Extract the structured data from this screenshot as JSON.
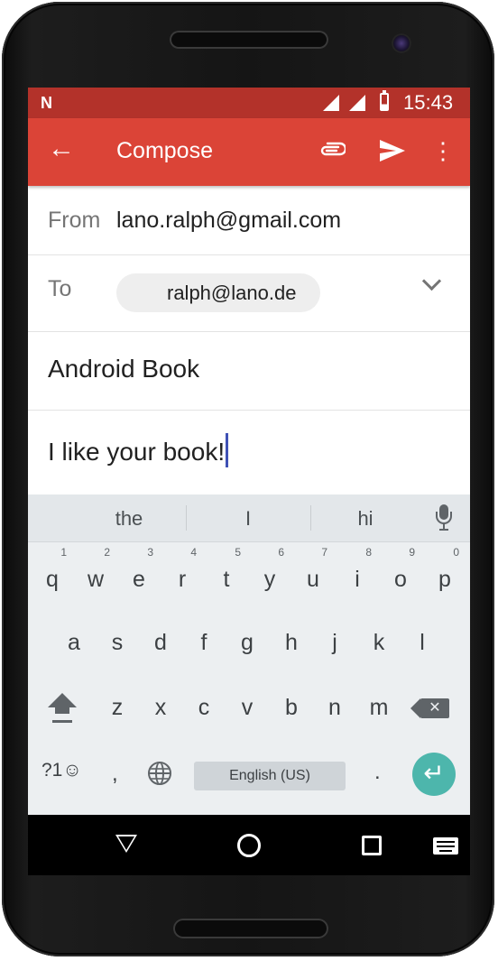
{
  "status_bar": {
    "notification_icon": "N",
    "time": "15:43"
  },
  "app_bar": {
    "back_icon": "←",
    "title": "Compose",
    "attach_icon": "paperclip-icon",
    "send_icon": "➤",
    "more_icon": "⋮"
  },
  "compose": {
    "from_label": "From",
    "from_value": "lano.ralph@gmail.com",
    "to_label": "To",
    "to_chip": "ralph@lano.de",
    "subject": "Android Book",
    "body": "I like your book!"
  },
  "keyboard": {
    "suggestions": [
      "the",
      "I",
      "hi"
    ],
    "row1": [
      {
        "key": "q",
        "hint": "1"
      },
      {
        "key": "w",
        "hint": "2"
      },
      {
        "key": "e",
        "hint": "3"
      },
      {
        "key": "r",
        "hint": "4"
      },
      {
        "key": "t",
        "hint": "5"
      },
      {
        "key": "y",
        "hint": "6"
      },
      {
        "key": "u",
        "hint": "7"
      },
      {
        "key": "i",
        "hint": "8"
      },
      {
        "key": "o",
        "hint": "9"
      },
      {
        "key": "p",
        "hint": "0"
      }
    ],
    "row2": [
      "a",
      "s",
      "d",
      "f",
      "g",
      "h",
      "j",
      "k",
      "l"
    ],
    "row3": [
      "z",
      "x",
      "c",
      "v",
      "b",
      "n",
      "m"
    ],
    "symbols_label": "?1☺",
    "comma": ",",
    "space_label": "English (US)",
    "period": ".",
    "enter_icon": "↵",
    "backspace_icon": "✕"
  },
  "colors": {
    "status_bar": "#b3322a",
    "app_bar": "#db4437",
    "enter_key": "#4db6ac",
    "cursor": "#3f51b5"
  }
}
